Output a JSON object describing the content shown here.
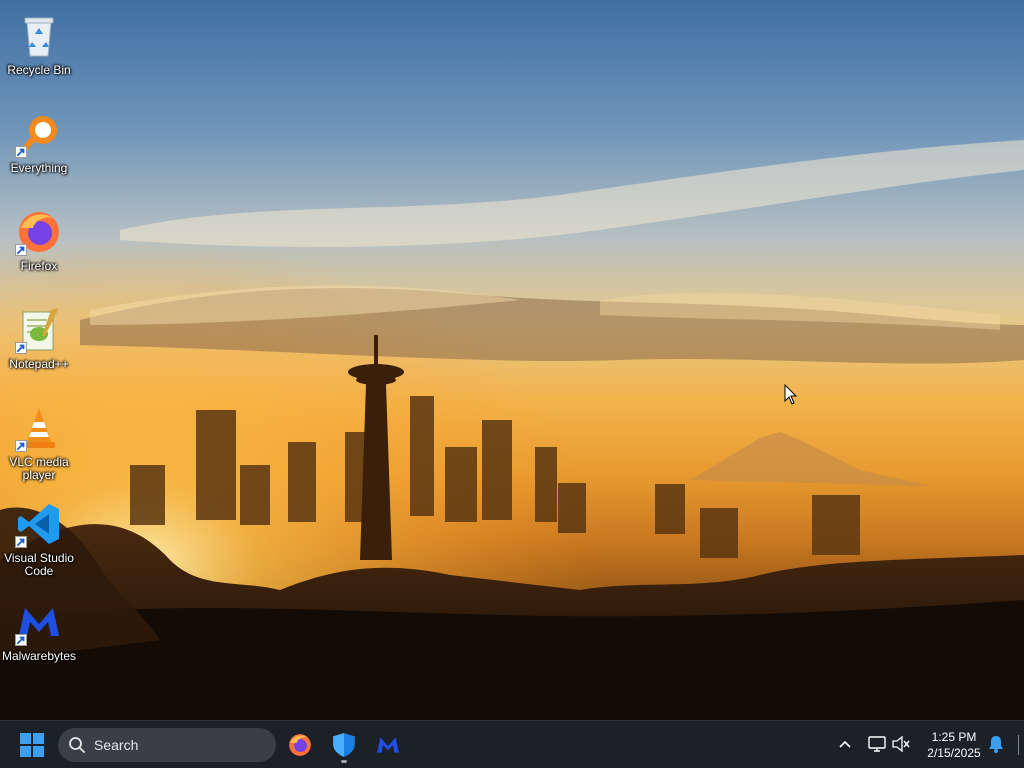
{
  "desktop": {
    "icons": [
      {
        "label": "Recycle Bin",
        "icon": "recycle-bin-icon",
        "shortcut": false
      },
      {
        "label": "Everything",
        "icon": "everything-search-icon",
        "shortcut": true
      },
      {
        "label": "Firefox",
        "icon": "firefox-icon",
        "shortcut": true
      },
      {
        "label": "Notepad++",
        "icon": "notepad-plus-plus-icon",
        "shortcut": true
      },
      {
        "label": "VLC media player",
        "icon": "vlc-cone-icon",
        "shortcut": true
      },
      {
        "label": "Visual Studio Code",
        "icon": "vscode-icon",
        "shortcut": true
      },
      {
        "label": "Malwarebytes",
        "icon": "malwarebytes-icon",
        "shortcut": true
      }
    ]
  },
  "taskbar": {
    "search_placeholder": "Search",
    "pinned_apps": [
      "firefox-icon",
      "windows-security-icon",
      "malwarebytes-icon"
    ],
    "clock": {
      "time": "1:25 PM",
      "date": "2/15/2025"
    },
    "colors": {
      "taskbar_bg": "#1c2127",
      "accent": "#0a84ff"
    }
  }
}
